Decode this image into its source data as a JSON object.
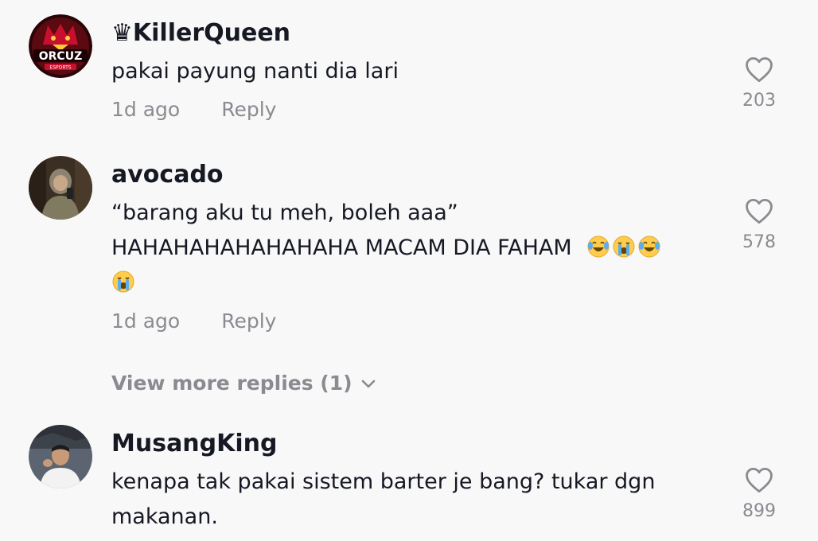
{
  "comments": [
    {
      "username": "♛KillerQueen",
      "lines": [
        "pakai payung nanti dia lari"
      ],
      "time": "1d ago",
      "reply_label": "Reply",
      "likes": "203",
      "avatar_text": "ORCUZ",
      "avatar_subtext": "ESPORTS"
    },
    {
      "username": "avocado",
      "lines": [
        "“barang aku tu meh, boleh aaa”",
        "HAHAHAHAHAHAHAHA MACAM DIA FAHAM"
      ],
      "emojis_line2": [
        "laughing-tears",
        "crying",
        "laughing-tears"
      ],
      "emojis_line3": [
        "crying"
      ],
      "time": "1d ago",
      "reply_label": "Reply",
      "likes": "578"
    },
    {
      "username": "MusangKing",
      "lines": [
        "kenapa tak pakai sistem barter je bang? tukar dgn",
        "makanan."
      ],
      "likes": "899"
    }
  ],
  "view_more": "View more replies (1)",
  "colors": {
    "background": "#f8f8f8",
    "text": "#161823",
    "muted": "#8a8b91"
  }
}
